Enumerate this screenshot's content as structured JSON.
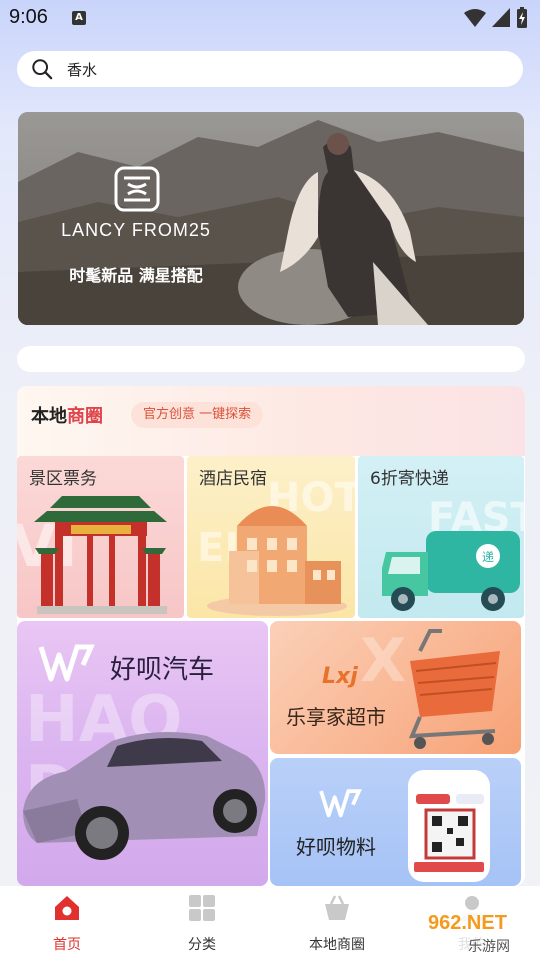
{
  "status_bar": {
    "time": "9:06",
    "notification_icon": "a-icon"
  },
  "search": {
    "value": "香水"
  },
  "banner": {
    "brand": "LANCY FROM25",
    "slogan": "时髦新品 满星搭配"
  },
  "local_section": {
    "title_prefix": "本地",
    "title_accent": "商圈",
    "subtitle": "官方创意 一键探索",
    "tiles": [
      {
        "label": "景区票务",
        "bg_word": "VIEW"
      },
      {
        "label": "酒店民宿",
        "bg_word": "HOT"
      },
      {
        "label": "6折寄快递",
        "bg_word": "FAST"
      }
    ],
    "car": {
      "title": "好呗汽车",
      "bg_word": "HAO BEI"
    },
    "market": {
      "title": "乐享家超市",
      "logo_text": "LXJ"
    },
    "material": {
      "title": "好呗物料"
    }
  },
  "bottom_nav": [
    {
      "label": "首页",
      "icon": "home-icon",
      "active": true
    },
    {
      "label": "分类",
      "icon": "category-icon",
      "active": false
    },
    {
      "label": "本地商圈",
      "icon": "basket-icon",
      "active": false
    },
    {
      "label": "我的",
      "icon": "profile-icon",
      "active": false
    }
  ],
  "watermark": {
    "text": "962.NET",
    "sub": "乐游网"
  },
  "colors": {
    "accent": "#e0312e",
    "search_bg": "#ffffff",
    "car_tile": "#dcb6f0",
    "market_tile": "#f7a276",
    "material_tile": "#a6c3f6"
  }
}
